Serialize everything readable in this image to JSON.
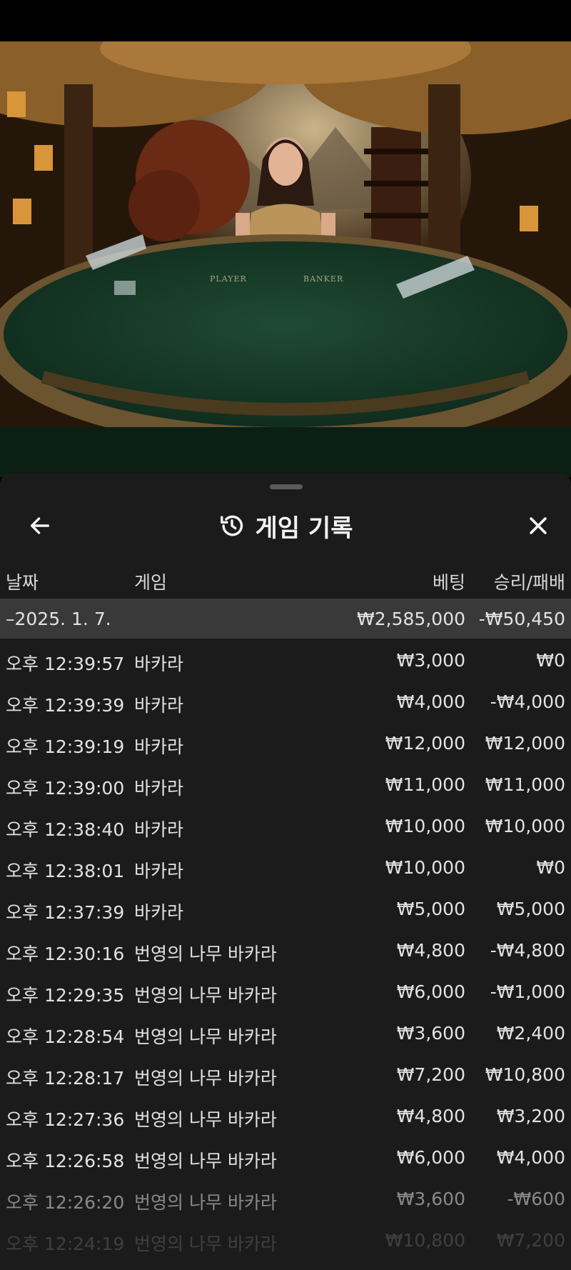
{
  "video": {
    "table_labels": [
      "PLAYER",
      "BANKER"
    ]
  },
  "sheet": {
    "title": "게임 기록",
    "icons": {
      "back": "arrow-left-icon",
      "history": "history-icon",
      "close": "close-icon"
    },
    "columns": {
      "date": "날짜",
      "game": "게임",
      "bet": "베팅",
      "result": "승리/패배"
    },
    "summary": {
      "date": "–2025. 1. 7.",
      "bet": "₩2,585,000",
      "result": "-₩50,450"
    },
    "rows": [
      {
        "time": "오후 12:39:57",
        "game": "바카라",
        "bet": "₩3,000",
        "result": "₩0"
      },
      {
        "time": "오후 12:39:39",
        "game": "바카라",
        "bet": "₩4,000",
        "result": "-₩4,000"
      },
      {
        "time": "오후 12:39:19",
        "game": "바카라",
        "bet": "₩12,000",
        "result": "₩12,000"
      },
      {
        "time": "오후 12:39:00",
        "game": "바카라",
        "bet": "₩11,000",
        "result": "₩11,000"
      },
      {
        "time": "오후 12:38:40",
        "game": "바카라",
        "bet": "₩10,000",
        "result": "₩10,000"
      },
      {
        "time": "오후 12:38:01",
        "game": "바카라",
        "bet": "₩10,000",
        "result": "₩0"
      },
      {
        "time": "오후 12:37:39",
        "game": "바카라",
        "bet": "₩5,000",
        "result": "₩5,000"
      },
      {
        "time": "오후 12:30:16",
        "game": "번영의 나무 바카라",
        "bet": "₩4,800",
        "result": "-₩4,800"
      },
      {
        "time": "오후 12:29:35",
        "game": "번영의 나무 바카라",
        "bet": "₩6,000",
        "result": "-₩1,000"
      },
      {
        "time": "오후 12:28:54",
        "game": "번영의 나무 바카라",
        "bet": "₩3,600",
        "result": "₩2,400"
      },
      {
        "time": "오후 12:28:17",
        "game": "번영의 나무 바카라",
        "bet": "₩7,200",
        "result": "₩10,800"
      },
      {
        "time": "오후 12:27:36",
        "game": "번영의 나무 바카라",
        "bet": "₩4,800",
        "result": "₩3,200"
      },
      {
        "time": "오후 12:26:58",
        "game": "번영의 나무 바카라",
        "bet": "₩6,000",
        "result": "₩4,000"
      },
      {
        "time": "오후 12:26:20",
        "game": "번영의 나무 바카라",
        "bet": "₩3,600",
        "result": "-₩600"
      },
      {
        "time": "오후 12:24:19",
        "game": "번영의 나무 바카라",
        "bet": "₩10,800",
        "result": "₩7,200"
      }
    ]
  }
}
